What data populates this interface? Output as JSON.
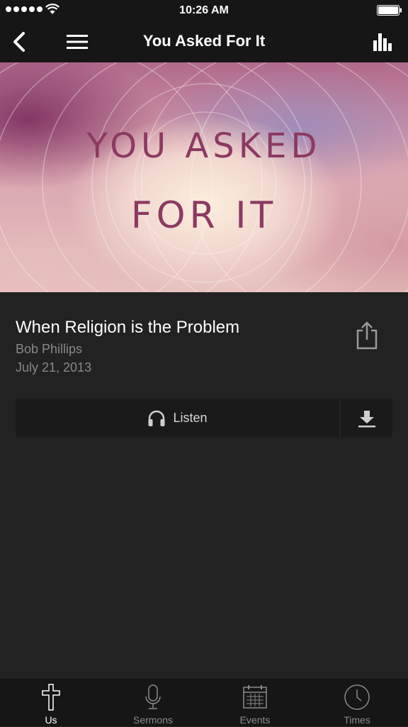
{
  "status_bar": {
    "time": "10:26 AM"
  },
  "nav": {
    "title": "You Asked For It"
  },
  "hero": {
    "line1": "YOU ASKED",
    "line2": "FOR IT"
  },
  "sermon": {
    "title": "When Religion is the Problem",
    "speaker": "Bob Phillips",
    "date": "July 21, 2013"
  },
  "actions": {
    "listen_label": "Listen"
  },
  "tabs": [
    {
      "label": "Us",
      "icon": "cross-icon",
      "active": true
    },
    {
      "label": "Sermons",
      "icon": "microphone-icon",
      "active": false
    },
    {
      "label": "Events",
      "icon": "calendar-icon",
      "active": false
    },
    {
      "label": "Times",
      "icon": "clock-icon",
      "active": false
    }
  ],
  "colors": {
    "background": "#222222",
    "bar": "#161616",
    "button": "#1a1a1a",
    "muted_text": "#888888",
    "hero_text": "#8c3a62"
  }
}
